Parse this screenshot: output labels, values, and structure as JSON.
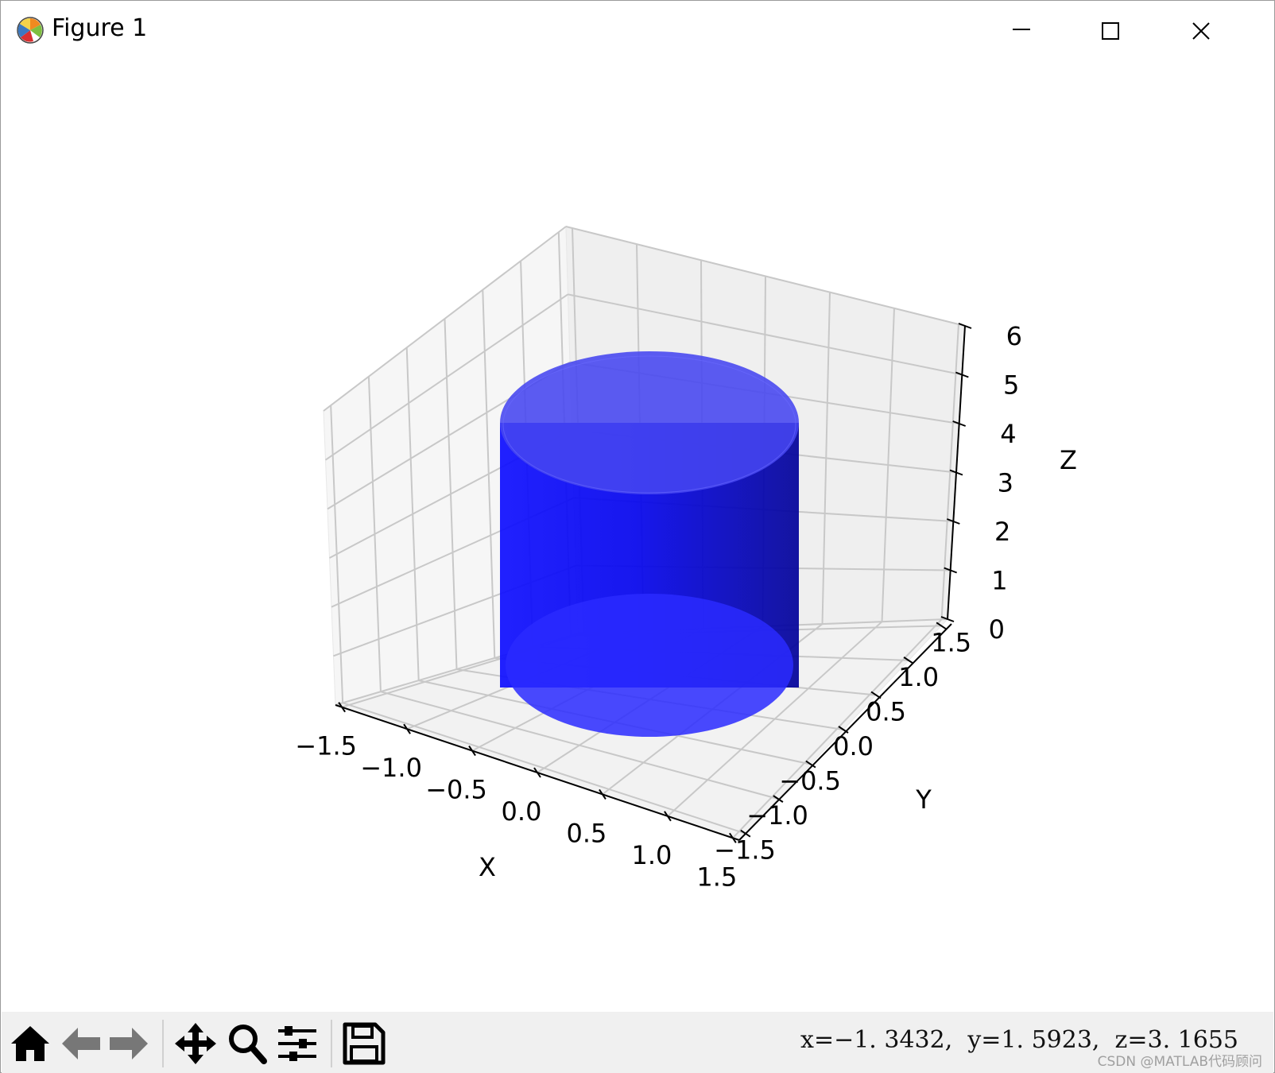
{
  "window": {
    "title": "Figure 1"
  },
  "toolbar": {
    "buttons": [
      "home-icon",
      "back-icon",
      "forward-icon",
      "pan-icon",
      "zoom-icon",
      "configure-subplots-icon",
      "save-icon"
    ],
    "coords": "x=−1. 3432,  y=1. 5923,  z=3. 1655",
    "watermark": "CSDN @MATLAB代码顾问"
  },
  "chart_data": {
    "type": "surface3d",
    "description_shape": "cylinder",
    "surface_color": "#0000ff",
    "surface_alpha": 0.6,
    "radius": 1,
    "height": [
      0,
      6
    ],
    "xlabel": "X",
    "ylabel": "Y",
    "zlabel": "Z",
    "xlim": [
      -1.5,
      1.5
    ],
    "ylim": [
      -1.5,
      1.5
    ],
    "zlim": [
      0,
      6
    ],
    "xticks": [
      "−1.5",
      "−1.0",
      "−0.5",
      "0.0",
      "0.5",
      "1.0",
      "1.5"
    ],
    "yticks": [
      "−1.5",
      "−1.0",
      "−0.5",
      "0.0",
      "0.5",
      "1.0",
      "1.5"
    ],
    "zticks": [
      "0",
      "1",
      "2",
      "3",
      "4",
      "5",
      "6"
    ],
    "grid": true
  }
}
